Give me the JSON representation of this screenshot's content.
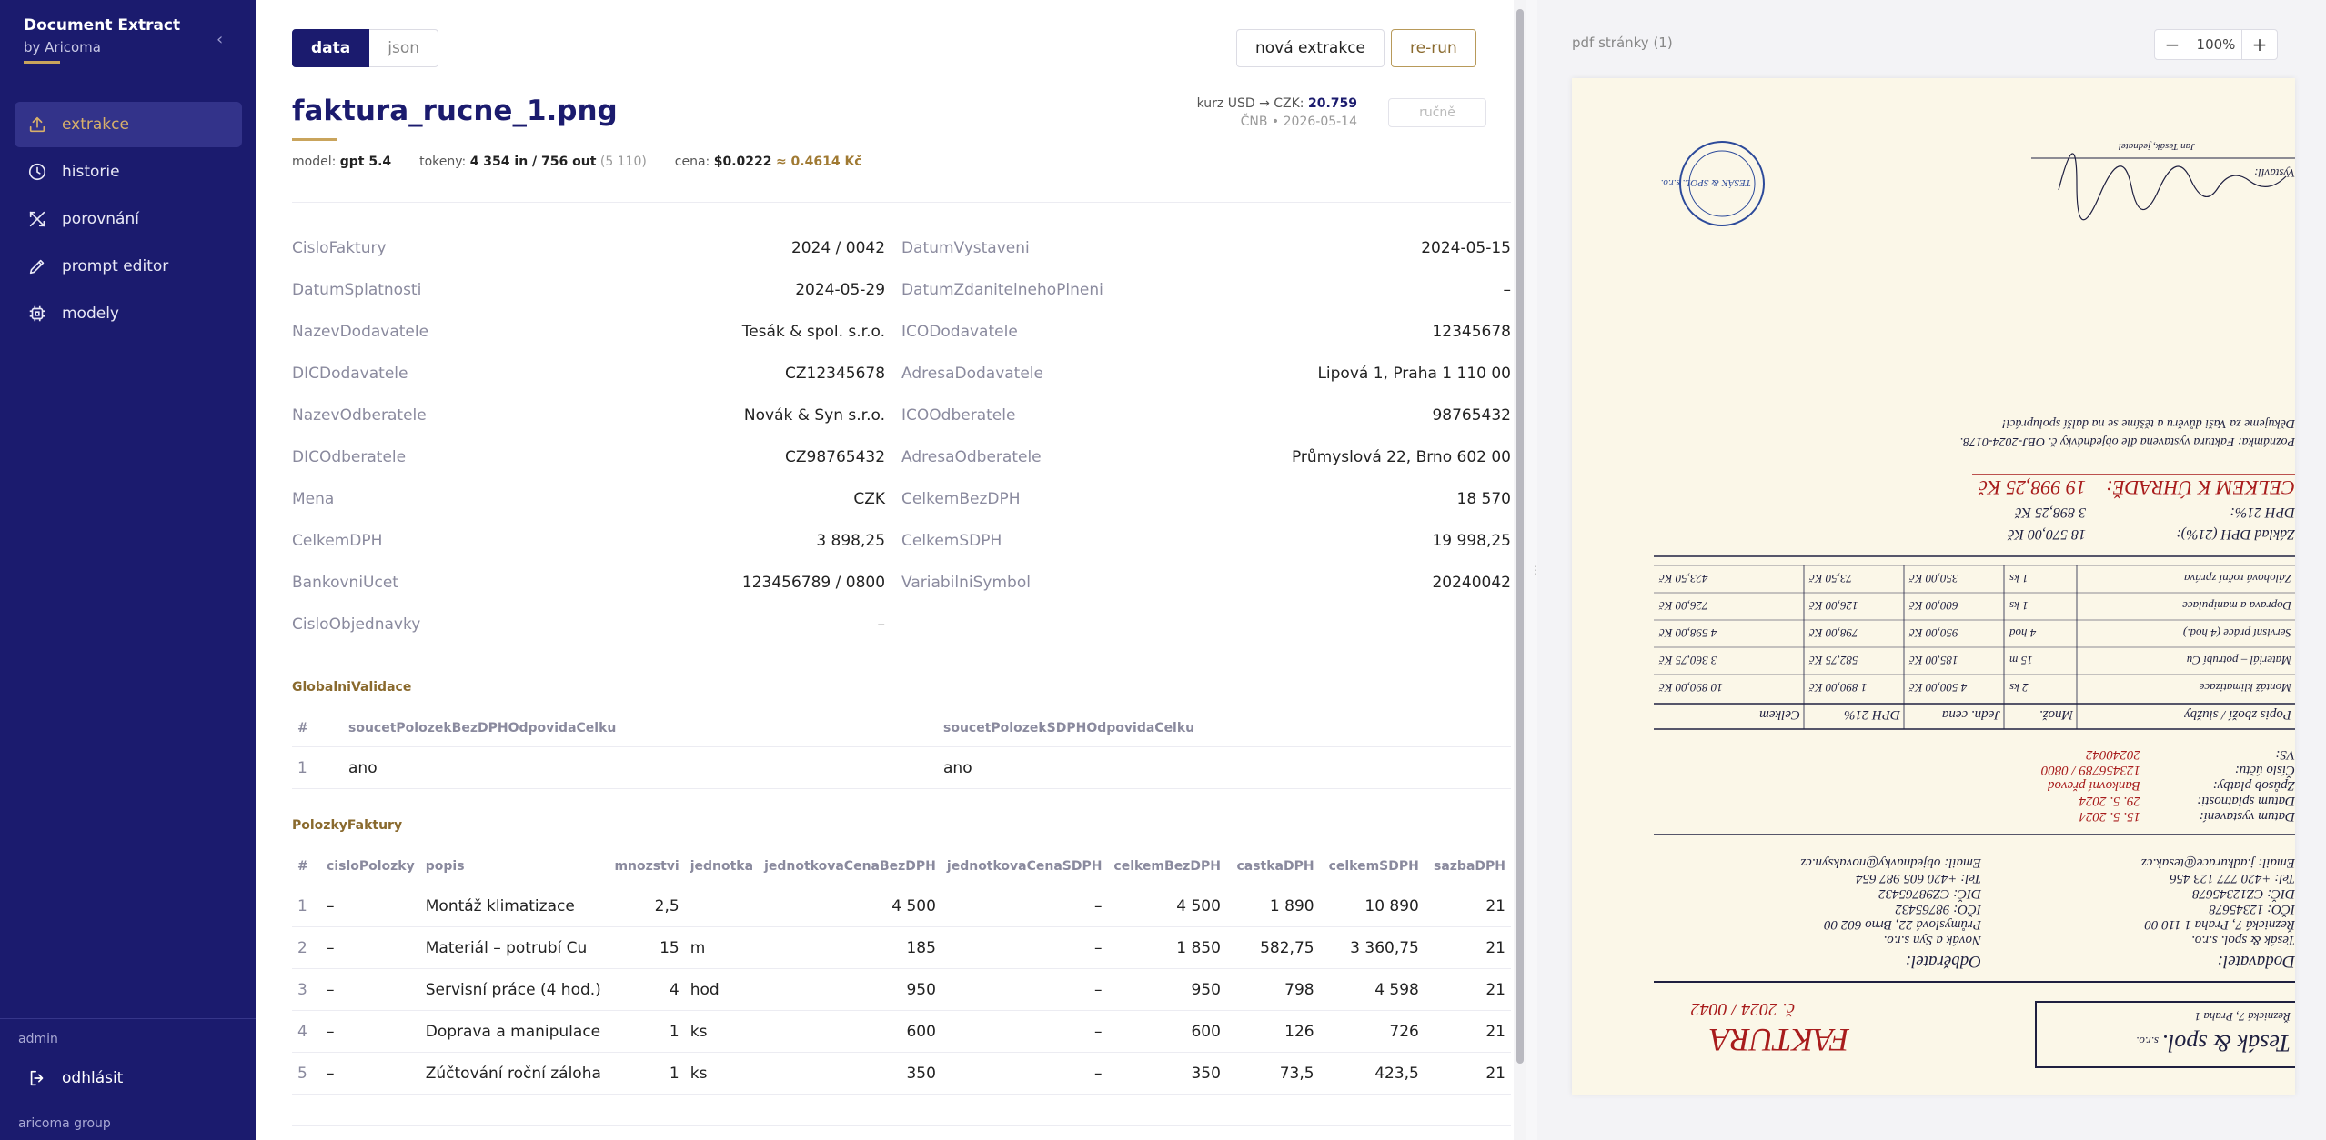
{
  "sidebar": {
    "brand_title": "Document Extract",
    "brand_subtitle": "by Aricoma",
    "collapse_icon": "‹",
    "nav": [
      {
        "label": "extrakce",
        "icon": "upload-icon",
        "active": true
      },
      {
        "label": "historie",
        "icon": "clock-icon"
      },
      {
        "label": "porovnání",
        "icon": "compare-icon"
      },
      {
        "label": "prompt editor",
        "icon": "pencil-icon"
      },
      {
        "label": "modely",
        "icon": "chip-icon"
      }
    ],
    "user": "admin",
    "logout_label": "odhlásit",
    "footer": "aricoma group"
  },
  "toolbar": {
    "tab_data": "data",
    "tab_json": "json",
    "new_label": "nová extrakce",
    "rerun_label": "re-run"
  },
  "document": {
    "filename": "faktura_rucne_1.png",
    "rate_prefix": "kurz USD → CZK:",
    "rate_value": "20.759",
    "rate_source": "ČNB • 2026-05-14",
    "manual_label": "ručně",
    "model_label": "model:",
    "model": "gpt 5.4",
    "tokens_label": "tokeny:",
    "tokens": "4 354 in / 756 out",
    "tokens_total": "(5 110)",
    "cost_label": "cena:",
    "cost_usd": "$0.0222",
    "cost_czk": "≈ 0.4614 Kč"
  },
  "fields": [
    [
      "CisloFaktury",
      "2024 / 0042",
      "DatumVystaveni",
      "2024-05-15"
    ],
    [
      "DatumSplatnosti",
      "2024-05-29",
      "DatumZdanitelnehoPlneni",
      "–"
    ],
    [
      "NazevDodavatele",
      "Tesák & spol. s.r.o.",
      "ICODodavatele",
      "12345678"
    ],
    [
      "DICDodavatele",
      "CZ12345678",
      "AdresaDodavatele",
      "Lipová 1, Praha 1 110 00"
    ],
    [
      "NazevOdberatele",
      "Novák & Syn s.r.o.",
      "ICOOdberatele",
      "98765432"
    ],
    [
      "DICOdberatele",
      "CZ98765432",
      "AdresaOdberatele",
      "Průmyslová 22, Brno 602 00"
    ],
    [
      "Mena",
      "CZK",
      "CelkemBezDPH",
      "18 570"
    ],
    [
      "CelkemDPH",
      "3 898,25",
      "CelkemSDPH",
      "19 998,25"
    ],
    [
      "BankovniUcet",
      "123456789 / 0800",
      "VariabilniSymbol",
      "20240042"
    ],
    [
      "CisloObjednavky",
      "–",
      "",
      ""
    ]
  ],
  "validation": {
    "title": "GlobalniValidace",
    "headers": [
      "#",
      "soucetPolozekBezDPHOdpovidaCelku",
      "soucetPolozekSDPHOdpovidaCelku"
    ],
    "rows": [
      [
        "1",
        "ano",
        "ano"
      ]
    ]
  },
  "items": {
    "title": "PolozkyFaktury",
    "headers": [
      "#",
      "cisloPolozky",
      "popis",
      "mnozstvi",
      "jednotka",
      "jednotkovaCenaBezDPH",
      "jednotkovaCenaSDPH",
      "celkemBezDPH",
      "castkaDPH",
      "celkemSDPH",
      "sazbaDPH"
    ],
    "rows": [
      [
        "1",
        "–",
        "Montáž klimatizace",
        "2,5",
        "",
        "4 500",
        "–",
        "4 500",
        "1 890",
        "10 890",
        "21"
      ],
      [
        "2",
        "–",
        "Materiál – potrubí Cu",
        "15",
        "m",
        "185",
        "–",
        "1 850",
        "582,75",
        "3 360,75",
        "21"
      ],
      [
        "3",
        "–",
        "Servisní práce (4 hod.)",
        "4",
        "hod",
        "950",
        "–",
        "950",
        "798",
        "4 598",
        "21"
      ],
      [
        "4",
        "–",
        "Doprava a manipulace",
        "1",
        "ks",
        "600",
        "–",
        "600",
        "126",
        "726",
        "21"
      ],
      [
        "5",
        "–",
        "Zúčtování roční záloha",
        "1",
        "ks",
        "350",
        "–",
        "350",
        "73,5",
        "423,5",
        "21"
      ]
    ]
  },
  "viewer": {
    "label": "pdf stránky (1)",
    "zoom_minus": "−",
    "zoom_value": "100%",
    "zoom_plus": "+"
  },
  "invoice_page": {
    "title": "FAKTURA",
    "number": "č. 2024 / 0042",
    "supplier_box_name": "Tesák & spol.",
    "supplier_box_sub": "s.r.o.",
    "supplier_box_addr": "Řeznická 7, Praha 1",
    "dodavatel_label": "Dodavatel:",
    "odberatel_label": "Odběratel:",
    "supplier_lines": [
      "Tesák & spol. s.r.o.",
      "Řeznická 7, Praha 1 110 00",
      "IČO: 12345678",
      "DIČ: CZ12345678",
      "Tel: +420 777 123 456",
      "Email: j.adkurace@tesak.cz"
    ],
    "customer_lines": [
      "Novák a Syn s.r.o.",
      "Průmyslová 22, Brno 602 00",
      "IČO: 98765432",
      "DIČ: CZ98765432",
      "Tel: +420 605 987 654",
      "Email: objednavky@novaksyn.cz"
    ],
    "date_rows": [
      [
        "Datum vystavení:",
        "15. 5. 2024"
      ],
      [
        "Datum splatnosti:",
        "29. 5. 2024"
      ],
      [
        "Způsob platby:",
        "Bankovní převod"
      ],
      [
        "Číslo účtu:",
        "123456789 / 0800"
      ],
      [
        "VS:",
        "20240042"
      ]
    ],
    "table_header": [
      "Popis zboží / služby",
      "Množ.",
      "Jedn. cena",
      "DPH 21%",
      "Celkem"
    ],
    "table_rows": [
      [
        "Montáž klimatizace",
        "2 ks",
        "4 500,00 Kč",
        "1 890,00 Kč",
        "10 890,00 Kč"
      ],
      [
        "Materiál – potrubí Cu",
        "15 m",
        "185,00 Kč",
        "582,75 Kč",
        "3 360,75 Kč"
      ],
      [
        "Servisní práce (4 hod.)",
        "4 hod",
        "950,00 Kč",
        "798,00 Kč",
        "4 598,00 Kč"
      ],
      [
        "Doprava a manipulace",
        "1 ks",
        "600,00 Kč",
        "126,00 Kč",
        "726,00 Kč"
      ],
      [
        "Zálohová roční zpráva",
        "1 ks",
        "350,00 Kč",
        "73,50 Kč",
        "423,50 Kč"
      ]
    ],
    "base_label": "Základ DPH (21%):",
    "base_value": "18 570,00 Kč",
    "vat_label": "DPH 21%:",
    "vat_value": "3 898,25 Kč",
    "total_label": "CELKEM K ÚHRADĚ:",
    "total_value": "19 998,25 Kč",
    "note1": "Poznámka: Faktura vystavena dle objednávky č. OBJ-2024-0178.",
    "note2": "Děkujeme za Vaši důvěru a těšíme se na další spolupráci!",
    "issued_by_label": "Vystavil:",
    "issued_by_name": "Jan Tesák, jednatel",
    "stamp_text": "TESÁK & SPOL. s.r.o."
  }
}
